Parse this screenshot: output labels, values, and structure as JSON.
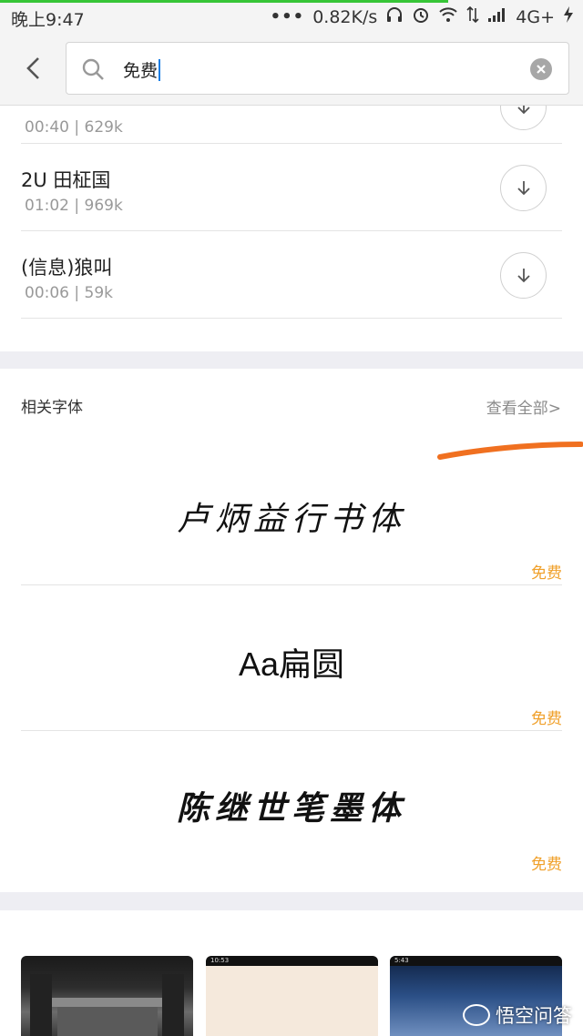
{
  "status_bar": {
    "time": "晚上9:47",
    "dots": "•••",
    "speed": "0.82K/s",
    "network": "4G+",
    "progress_color": "#37c537"
  },
  "header": {
    "back_icon": "chevron-left-icon",
    "search_icon": "search-icon",
    "search_value": "免费",
    "clear_icon": "clear-icon"
  },
  "sounds": [
    {
      "title": "",
      "meta": "00:40  |  629k"
    },
    {
      "title": "2U 田柾国",
      "meta": "01:02  |  969k"
    },
    {
      "title": "(信息)狼叫",
      "meta": "00:06  |  59k"
    }
  ],
  "fonts_section": {
    "title": "相关字体",
    "view_all": "查看全部>",
    "items": [
      {
        "name": "卢炳益行书体",
        "badge": "免费"
      },
      {
        "name": "Aa扁圆",
        "badge": "免费"
      },
      {
        "name": "陈继世笔墨体",
        "badge": "免费"
      }
    ]
  },
  "thumbs": [
    {
      "status": ""
    },
    {
      "status": "10:53"
    },
    {
      "status": "5:43"
    }
  ],
  "watermark": "悟空问答",
  "colors": {
    "accent_orange": "#f0a02a",
    "annotation_orange": "#f07020",
    "band": "#eeeef3"
  }
}
